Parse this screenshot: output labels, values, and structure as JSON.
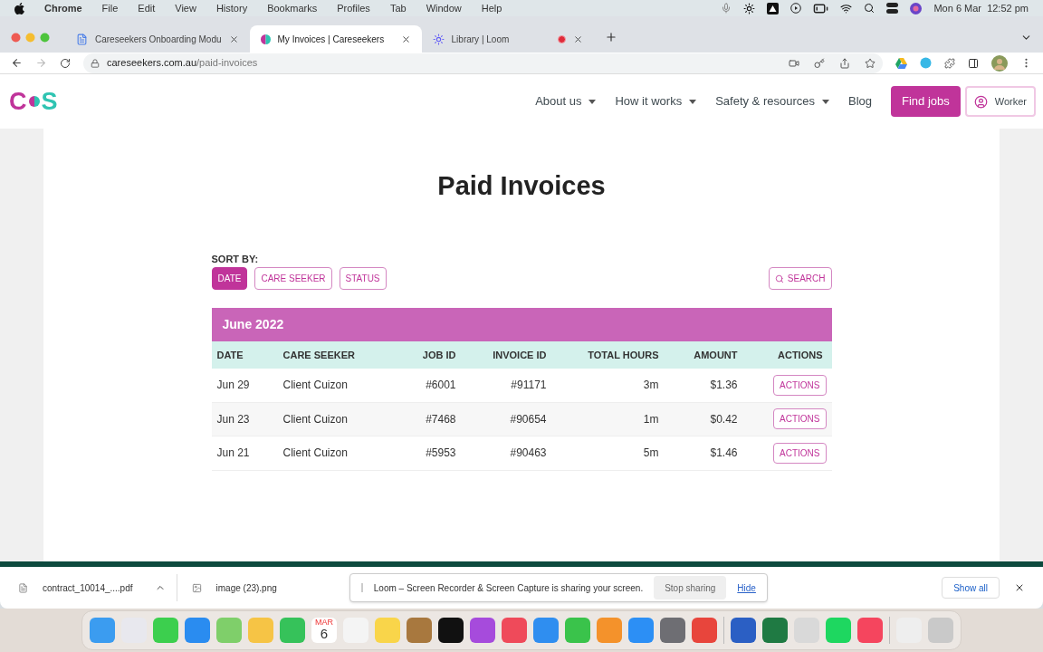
{
  "menu_bar": {
    "app": "Chrome",
    "menus": [
      "File",
      "Edit",
      "View",
      "History",
      "Bookmarks",
      "Profiles",
      "Tab",
      "Window",
      "Help"
    ],
    "date": "Mon 6 Mar",
    "time": "12:52 pm"
  },
  "tabs": [
    {
      "title": "Careseekers Onboarding Modu",
      "selected": false,
      "kind": "doc"
    },
    {
      "title": "My Invoices | Careseekers",
      "selected": true,
      "kind": "site"
    },
    {
      "title": "Library | Loom",
      "selected": false,
      "kind": "loom",
      "recording": true
    }
  ],
  "address": {
    "domain": "careseekers.com.au",
    "path": "/paid-invoices"
  },
  "site_nav": {
    "logo": {
      "left": "C",
      "right": "S"
    },
    "menus": [
      {
        "label": "About us"
      },
      {
        "label": "How it works"
      },
      {
        "label": "Safety & resources"
      }
    ],
    "blog": "Blog",
    "find_jobs": "Find jobs",
    "account": "Worker"
  },
  "page": {
    "title": "Paid Invoices",
    "sort_label": "SORT BY:",
    "sort_options": [
      {
        "label": "DATE",
        "selected": true
      },
      {
        "label": "CARE SEEKER",
        "selected": false
      },
      {
        "label": "STATUS",
        "selected": false
      }
    ],
    "search": "SEARCH"
  },
  "table": {
    "group": "June 2022",
    "columns": [
      "DATE",
      "CARE SEEKER",
      "JOB ID",
      "INVOICE ID",
      "TOTAL HOURS",
      "AMOUNT",
      "ACTIONS"
    ],
    "rows": [
      {
        "date": "Jun 29",
        "care_seeker": "Client Cuizon",
        "job_id": "#6001",
        "invoice_id": "#91171",
        "hours": "3m",
        "amount": "$1.36",
        "action": "ACTIONS"
      },
      {
        "date": "Jun 23",
        "care_seeker": "Client Cuizon",
        "job_id": "#7468",
        "invoice_id": "#90654",
        "hours": "1m",
        "amount": "$0.42",
        "action": "ACTIONS"
      },
      {
        "date": "Jun 21",
        "care_seeker": "Client Cuizon",
        "job_id": "#5953",
        "invoice_id": "#90463",
        "hours": "5m",
        "amount": "$1.46",
        "action": "ACTIONS"
      }
    ]
  },
  "downloads": {
    "files": [
      {
        "name": "contract_10014_....pdf"
      },
      {
        "name": "image (23).png"
      }
    ],
    "sharing": {
      "message": "Loom – Screen Recorder & Screen Capture is sharing your screen.",
      "stop": "Stop sharing",
      "hide": "Hide"
    },
    "show_all": "Show all"
  },
  "dock": [
    {
      "color": "#3b9cf0"
    },
    {
      "color": "#e8e8ee"
    },
    {
      "color": "#3ccf4e"
    },
    {
      "color": "#2a8cf0"
    },
    {
      "color": "#7fcf6a"
    },
    {
      "color": "#f6c445"
    },
    {
      "color": "#36c25a"
    },
    {
      "kind": "calendar",
      "month": "MAR",
      "day": "6"
    },
    {
      "color": "#f4f4f4"
    },
    {
      "color": "#f9d54a"
    },
    {
      "color": "#a8783e"
    },
    {
      "color": "#111111"
    },
    {
      "color": "#a64bdc"
    },
    {
      "color": "#ef4a5a"
    },
    {
      "color": "#2f8ef0"
    },
    {
      "color": "#3ac34b"
    },
    {
      "color": "#f4922b"
    },
    {
      "color": "#2c8ff5"
    },
    {
      "color": "#6e6e73"
    },
    {
      "color": "#e8453c"
    },
    {
      "kind": "gap"
    },
    {
      "color": "#2b5fc4"
    },
    {
      "color": "#1f7a43"
    },
    {
      "color": "#d9d9d9"
    },
    {
      "color": "#1ed760"
    },
    {
      "color": "#f5455e"
    },
    {
      "kind": "gap"
    },
    {
      "color": "#eeeeee"
    },
    {
      "color": "#c9c9c9"
    }
  ]
}
